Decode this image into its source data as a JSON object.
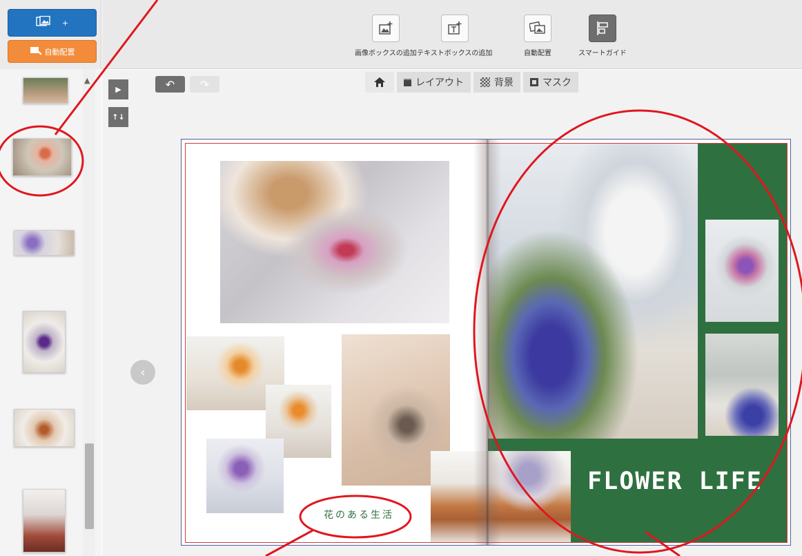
{
  "sidebar": {
    "add_photos_label": "+",
    "auto_layout_label": "自動配置",
    "thumbnails": [
      "page-1",
      "page-2",
      "page-3",
      "page-4",
      "page-5",
      "page-6"
    ]
  },
  "toolbar": {
    "tools": [
      {
        "label": "画像ボックスの追加",
        "icon": "add-image-icon"
      },
      {
        "label": "テキストボックスの追加",
        "icon": "add-text-icon"
      },
      {
        "label": "自動配置",
        "icon": "auto-layout-icon"
      },
      {
        "label": "スマートガイド",
        "icon": "smart-guide-icon"
      }
    ]
  },
  "tabs": {
    "home_icon": "home-icon",
    "layout": "レイアウト",
    "background": "背景",
    "mask": "マスク"
  },
  "page": {
    "title": "FLOWER LIFE",
    "subtitle": "花のある生活"
  },
  "colors": {
    "accent_blue": "#2374c0",
    "accent_orange": "#f28c3a",
    "page_green": "#2f7040",
    "annotation_red": "#e0161e"
  }
}
